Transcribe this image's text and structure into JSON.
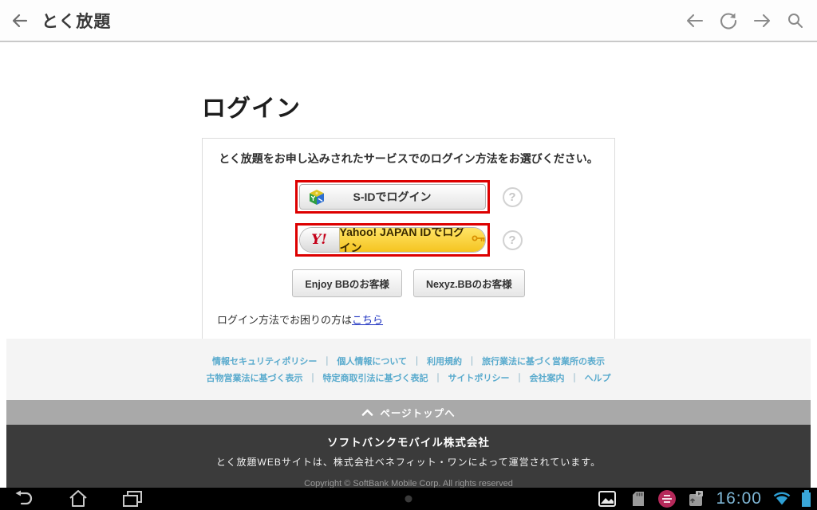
{
  "browser_bar": {
    "title": "とく放題"
  },
  "page": {
    "heading": "ログイン",
    "instruction": "とく放題をお申し込みされたサービスでのログイン方法をお選びください。",
    "sid_button_label": "S-IDでログイン",
    "yahoo_logo": "Y!",
    "yahoo_button_label": "Yahoo! JAPAN IDでログイン",
    "enjoy_bb_button_label": "Enjoy BBのお客様",
    "nexyz_bb_button_label": "Nexyz.BBのお客様",
    "help_question_mark": "?",
    "help_text": "ログイン方法でお困りの方は",
    "help_link_label": "こちら"
  },
  "footer_links": {
    "separator": "｜",
    "row1": [
      "情報セキュリティポリシー",
      "個人情報について",
      "利用規約",
      "旅行業法に基づく営業所の表示"
    ],
    "row2": [
      "古物営業法に基づく表示",
      "特定商取引法に基づく表記",
      "サイトポリシー",
      "会社案内",
      "ヘルプ"
    ]
  },
  "page_top": {
    "label": "ページトップへ"
  },
  "footer": {
    "company": "ソフトバンクモバイル株式会社",
    "operated_by": "とく放題WEBサイトは、株式会社ベネフィット・ワンによって運営されています。",
    "copyright": "Copyright © SoftBank Mobile Corp. All rights reserved"
  },
  "system_bar": {
    "clock": "16:00"
  },
  "colors": {
    "highlight_frame": "#dd0000",
    "yahoo_yellow": "#f5c420",
    "link_blue": "#1a2fc0",
    "footer_link_blue": "#58aacd",
    "holo_blue": "#3aa7da"
  }
}
